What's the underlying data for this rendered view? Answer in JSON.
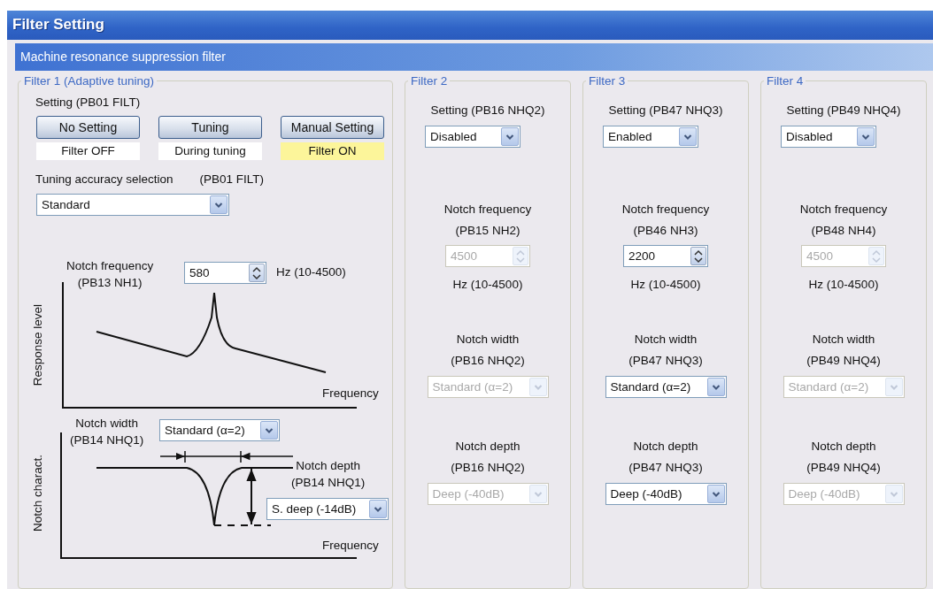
{
  "window": {
    "title": "Filter Setting"
  },
  "section": {
    "title": "Machine resonance suppression filter"
  },
  "filter_1": {
    "title": "Filter 1 (Adaptive tuning)",
    "setting_label": "Setting  (PB01 FILT)",
    "modes": [
      {
        "button": "No Setting",
        "status": "Filter OFF",
        "lit": false
      },
      {
        "button": "Tuning",
        "status": "During tuning",
        "lit": false
      },
      {
        "button": "Manual Setting",
        "status": "Filter ON",
        "lit": true
      }
    ],
    "accuracy": {
      "label": "Tuning accuracy selection",
      "param": "(PB01 FILT)",
      "value": "Standard"
    },
    "diagram": {
      "notch_frequency": {
        "label": "Notch frequency",
        "param": "(PB13 NH1)",
        "value": "580",
        "unit": "Hz (10-4500)"
      },
      "response_axis": "Response level",
      "response_x_axis": "Frequency",
      "notch_width": {
        "label": "Notch width",
        "param": "(PB14 NHQ1)",
        "value": "Standard (α=2)"
      },
      "notch_depth": {
        "label": "Notch depth",
        "param": "(PB14 NHQ1)",
        "value": "S. deep (-14dB)"
      },
      "notch_axis": "Notch charact.",
      "notch_x_axis": "Frequency"
    }
  },
  "filters": [
    {
      "title": "Filter 2",
      "setting": {
        "label": "Setting  (PB16 NHQ2)",
        "value": "Disabled"
      },
      "notch_frequency": {
        "label": "Notch frequency",
        "param": "(PB15 NH2)",
        "value": "4500",
        "unit": "Hz (10-4500)",
        "disabled": true
      },
      "notch_width": {
        "label": "Notch width",
        "param": "(PB16 NHQ2)",
        "value": "Standard (α=2)",
        "disabled": true
      },
      "notch_depth": {
        "label": "Notch depth",
        "param": "(PB16 NHQ2)",
        "value": "Deep (-40dB)",
        "disabled": true
      }
    },
    {
      "title": "Filter 3",
      "setting": {
        "label": "Setting  (PB47 NHQ3)",
        "value": "Enabled"
      },
      "notch_frequency": {
        "label": "Notch frequency",
        "param": "(PB46 NH3)",
        "value": "2200",
        "unit": "Hz (10-4500)",
        "disabled": false
      },
      "notch_width": {
        "label": "Notch width",
        "param": "(PB47 NHQ3)",
        "value": "Standard (α=2)",
        "disabled": false
      },
      "notch_depth": {
        "label": "Notch depth",
        "param": "(PB47 NHQ3)",
        "value": "Deep (-40dB)",
        "disabled": false
      }
    },
    {
      "title": "Filter 4",
      "setting": {
        "label": "Setting  (PB49 NHQ4)",
        "value": "Disabled"
      },
      "notch_frequency": {
        "label": "Notch frequency",
        "param": "(PB48 NH4)",
        "value": "4500",
        "unit": "Hz (10-4500)",
        "disabled": true
      },
      "notch_width": {
        "label": "Notch width",
        "param": "(PB49 NHQ4)",
        "value": "Standard (α=2)",
        "disabled": true
      },
      "notch_depth": {
        "label": "Notch depth",
        "param": "(PB49 NHQ4)",
        "value": "Deep (-40dB)",
        "disabled": true
      }
    }
  ]
}
